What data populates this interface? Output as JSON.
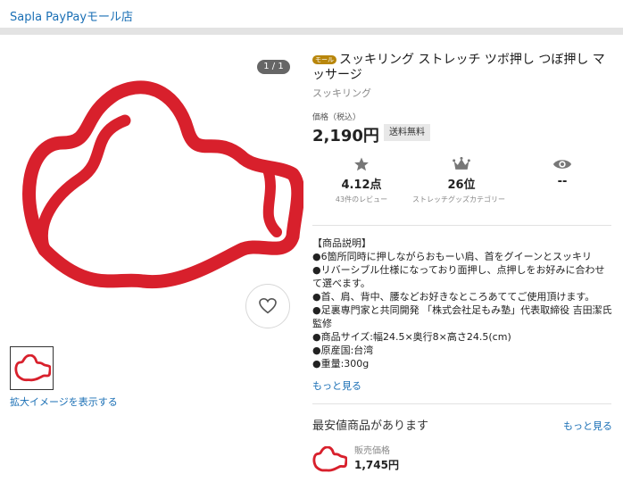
{
  "header": {
    "store_name": "Sapla PayPayモール店"
  },
  "gallery": {
    "page_indicator": "1 / 1",
    "enlarge_label": "拡大イメージを表示する",
    "product_color": "#d8202c"
  },
  "product": {
    "mall_badge": "モール",
    "title": "スッキリング ストレッチ ツボ押し つぼ押し マッサージ",
    "brand": "スッキリング",
    "price_label": "価格（税込）",
    "price": "2,190円",
    "shipping_badge": "送料無料"
  },
  "stats": [
    {
      "icon": "star-icon",
      "value": "4.12点",
      "sub": "43件のレビュー"
    },
    {
      "icon": "crown-icon",
      "value": "26位",
      "sub": "ストレッチグッズカテゴリー"
    },
    {
      "icon": "eye-icon",
      "value": "--",
      "sub": ""
    }
  ],
  "description": {
    "lines": [
      "【商品説明】",
      "●6箇所同時に押しながらおもーい肩、首をグイーンとスッキリ",
      "●リバーシブル仕様になっており面押し、点押しをお好みに合わせて選べます。",
      "●首、肩、背中、腰などお好きなところあててご使用頂けます。",
      "●足裏専門家と共同開発 「株式会社足もみ塾」代表取締役 吉田潔氏監修",
      "●商品サイズ:幅24.5×奥行8×高さ24.5(cm)",
      "●原産国:台湾",
      "●重量:300g"
    ],
    "more_label": "もっと見る"
  },
  "lowest": {
    "title": "最安値商品があります",
    "more_label": "もっと見る",
    "sale_label": "販売価格",
    "sale_price": "1,745円"
  }
}
